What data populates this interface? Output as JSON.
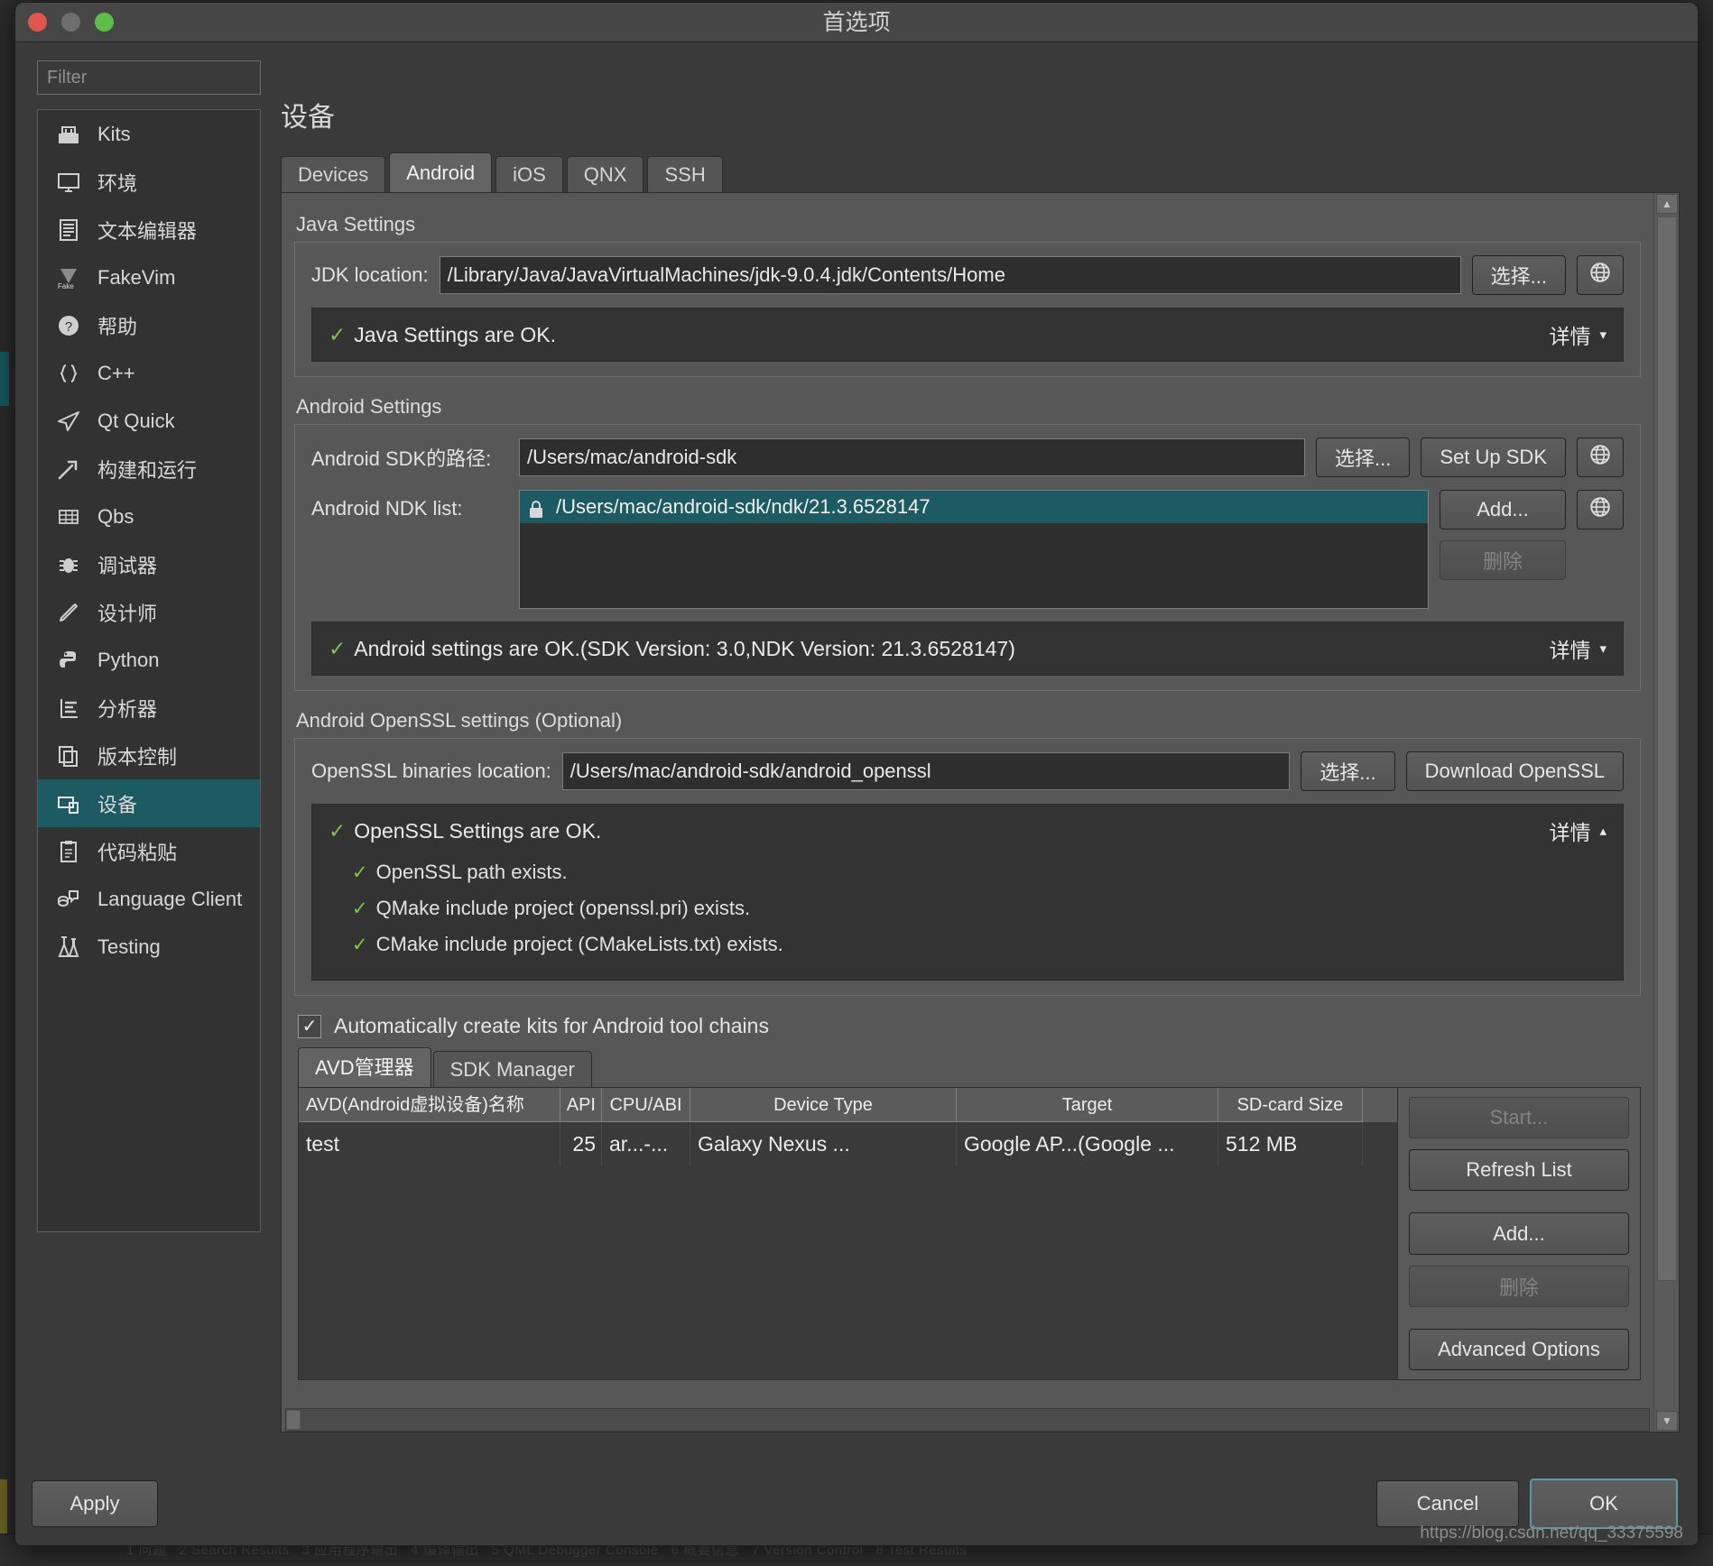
{
  "window": {
    "title": "首选项"
  },
  "sidebar": {
    "filter_placeholder": "Filter",
    "items": [
      {
        "label": "Kits",
        "icon": "kits-icon"
      },
      {
        "label": "环境",
        "icon": "monitor-icon"
      },
      {
        "label": "文本编辑器",
        "icon": "text-editor-icon"
      },
      {
        "label": "FakeVim",
        "icon": "fakevim-icon"
      },
      {
        "label": "帮助",
        "icon": "help-icon"
      },
      {
        "label": "C++",
        "icon": "braces-icon"
      },
      {
        "label": "Qt Quick",
        "icon": "paper-plane-icon"
      },
      {
        "label": "构建和运行",
        "icon": "hammer-icon"
      },
      {
        "label": "Qbs",
        "icon": "grid-icon"
      },
      {
        "label": "调试器",
        "icon": "bug-icon"
      },
      {
        "label": "设计师",
        "icon": "pencil-icon"
      },
      {
        "label": "Python",
        "icon": "python-icon"
      },
      {
        "label": "分析器",
        "icon": "analyzer-icon"
      },
      {
        "label": "版本控制",
        "icon": "version-control-icon"
      },
      {
        "label": "设备",
        "icon": "devices-icon",
        "selected": true
      },
      {
        "label": "代码粘贴",
        "icon": "clipboard-icon"
      },
      {
        "label": "Language Client",
        "icon": "language-client-icon"
      },
      {
        "label": "Testing",
        "icon": "testing-icon"
      }
    ]
  },
  "pane": {
    "title": "设备",
    "tabs": [
      {
        "label": "Devices",
        "active": false
      },
      {
        "label": "Android",
        "active": true
      },
      {
        "label": "iOS",
        "active": false
      },
      {
        "label": "QNX",
        "active": false
      },
      {
        "label": "SSH",
        "active": false
      }
    ]
  },
  "java_settings": {
    "group_label": "Java Settings",
    "jdk_label": "JDK location:",
    "jdk_value": "/Library/Java/JavaVirtualMachines/jdk-9.0.4.jdk/Contents/Home",
    "browse_label": "选择...",
    "globe_icon": "globe-icon",
    "status_text": "Java Settings are OK.",
    "details_label": "详情",
    "details_caret": "▾",
    "check_glyph": "✓"
  },
  "android_settings": {
    "group_label": "Android Settings",
    "sdk_label": "Android SDK的路径:",
    "sdk_value": "/Users/mac/android-sdk",
    "sdk_browse_label": "选择...",
    "setup_sdk_label": "Set Up SDK",
    "ndk_label": "Android NDK list:",
    "ndk_items": [
      {
        "path": "/Users/mac/android-sdk/ndk/21.3.6528147",
        "locked": true,
        "selected": true
      }
    ],
    "ndk_add_label": "Add...",
    "ndk_remove_label": "删除",
    "status_text": "Android settings are OK.(SDK Version: 3.0,NDK Version: 21.3.6528147)",
    "details_label": "详情",
    "details_caret": "▾",
    "globe_icon": "globe-icon",
    "lock_icon": "lock-icon",
    "check_glyph": "✓"
  },
  "openssl_settings": {
    "group_label": "Android OpenSSL settings (Optional)",
    "binaries_label": "OpenSSL binaries location:",
    "binaries_value": "/Users/mac/android-sdk/android_openssl",
    "browse_label": "选择...",
    "download_label": "Download OpenSSL",
    "status_text": "OpenSSL Settings are OK.",
    "details_label": "详情",
    "details_caret": "▴",
    "check_glyph": "✓",
    "sub_items": [
      "OpenSSL path exists.",
      "QMake include project (openssl.pri) exists.",
      "CMake include project (CMakeLists.txt) exists."
    ]
  },
  "auto_kits": {
    "label": "Automatically create kits for Android tool chains",
    "checked": true,
    "check_glyph": "✓"
  },
  "avd": {
    "tabs": [
      {
        "label": "AVD管理器",
        "active": true
      },
      {
        "label": "SDK Manager",
        "active": false
      }
    ],
    "columns": [
      "AVD(Android虚拟设备)名称",
      "API",
      "CPU/ABI",
      "Device Type",
      "Target",
      "SD-card Size"
    ],
    "rows": [
      {
        "name": "test",
        "api": "25",
        "cpu_abi": "ar...-...",
        "device_type": "Galaxy Nexus ...",
        "target": "Google AP...(Google ...",
        "sd_card": "512 MB"
      }
    ],
    "buttons": [
      {
        "label": "Start...",
        "disabled": true
      },
      {
        "label": "Refresh List",
        "disabled": false
      },
      {
        "label": "Add...",
        "disabled": false
      },
      {
        "label": "删除",
        "disabled": true
      },
      {
        "label": "Advanced Options",
        "disabled": false
      }
    ]
  },
  "footer": {
    "apply_label": "Apply",
    "cancel_label": "Cancel",
    "ok_label": "OK",
    "watermark": "https://blog.csdn.net/qq_33375598"
  },
  "colors": {
    "accent_teal": "#1d5b63",
    "ok_green": "#7ac943",
    "window_bg": "#3a3a3a",
    "focus_ring": "#5a9aa4"
  }
}
